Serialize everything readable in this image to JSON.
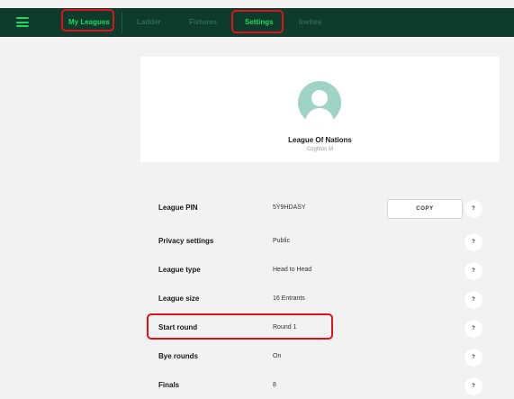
{
  "nav": {
    "items": [
      {
        "label": "My Leagues",
        "active": true
      },
      {
        "label": "Ladder",
        "active": false
      },
      {
        "label": "Fixtures",
        "active": false
      },
      {
        "label": "Settings",
        "active": true
      },
      {
        "label": "Invites",
        "active": false
      }
    ]
  },
  "profile": {
    "league_name": "League Of Nations",
    "owner": "Crighton M"
  },
  "settings": [
    {
      "label": "League PIN",
      "value": "5Y9HDASY",
      "action": "COPY"
    },
    {
      "label": "Privacy settings",
      "value": "Public"
    },
    {
      "label": "League type",
      "value": "Head to Head"
    },
    {
      "label": "League size",
      "value": "16 Entrants"
    },
    {
      "label": "Start round",
      "value": "Round 1"
    },
    {
      "label": "Bye rounds",
      "value": "On"
    },
    {
      "label": "Finals",
      "value": "8"
    }
  ],
  "help_label": "?",
  "colors": {
    "navbar": "#0e3b2b",
    "accent": "#1ed760",
    "inactive_nav": "#2a6e4f",
    "highlight": "#e0121b",
    "background": "#f2f2f2",
    "avatar": "#9fd3c6"
  }
}
